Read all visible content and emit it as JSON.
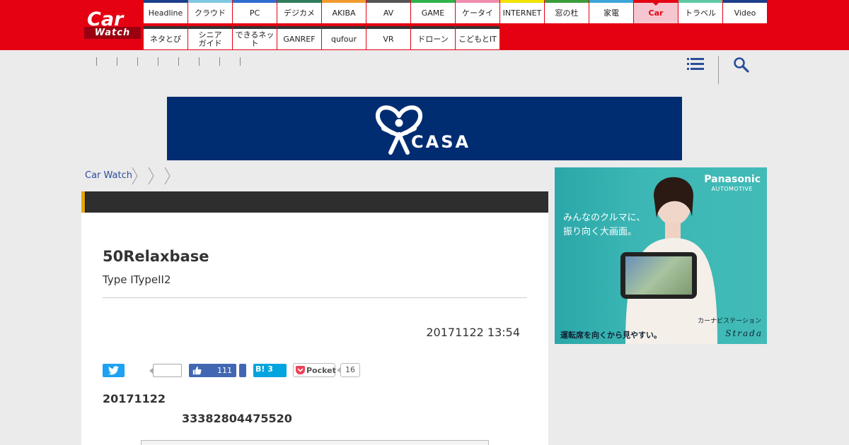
{
  "logo": {
    "line1": "Car",
    "line2": "Watch"
  },
  "nav": {
    "row1": [
      {
        "label": "Headline",
        "color": "#1d3f8b"
      },
      {
        "label": "クラウド",
        "color": "#7ec8e3"
      },
      {
        "label": "PC",
        "color": "#2f6ccf"
      },
      {
        "label": "デジカメ",
        "color": "#2e7d5b"
      },
      {
        "label": "AKIBA",
        "color": "#f29a2e"
      },
      {
        "label": "AV",
        "color": "#555555"
      },
      {
        "label": "GAME",
        "color": "#2db34a"
      },
      {
        "label": "ケータイ",
        "color": "#f08cb0"
      },
      {
        "label": "INTERNET",
        "color": "#f3e300"
      },
      {
        "label": "窓の杜",
        "color": "#3a9c3a"
      },
      {
        "label": "家電",
        "color": "#3da5d9"
      },
      {
        "label": "Car",
        "color": "#e50012",
        "active": true
      },
      {
        "label": "トラベル",
        "color": "#5fc9a5"
      },
      {
        "label": "Video",
        "color": "#1d3f8b"
      }
    ],
    "row2": [
      {
        "label": "ネタとぴ",
        "color": "#333333"
      },
      {
        "label": "シニア\nガイド",
        "color": "#333333"
      },
      {
        "label": "できるネット",
        "color": "#333333"
      },
      {
        "label": "GANREF",
        "color": "#333333"
      },
      {
        "label": "qufour",
        "color": "#333333"
      },
      {
        "label": "VR",
        "color": "#333333"
      },
      {
        "label": "ドローン",
        "color": "#333333"
      },
      {
        "label": "こどもとIT",
        "color": "#333333"
      }
    ]
  },
  "banner": {
    "text": "CASA"
  },
  "breadcrumb": {
    "home": "Car Watch"
  },
  "article": {
    "title": "50Relaxbase",
    "subtitle": "Type ITypeII2",
    "date": "20171122 13:54",
    "text1": "20171122",
    "text2": "33382804475520"
  },
  "share": {
    "facebook_count": "111",
    "hatena_label": "B! 3",
    "pocket_label": "Pocket",
    "pocket_count": "16"
  },
  "sidead": {
    "brand": "Panasonic",
    "brand_sub": "AUTOMOTIVE",
    "copy1": "みんなのクルマに、",
    "copy2": "振り向く大画面。",
    "product_type": "カーナビステーション",
    "tagline": "運転席を向くから見やすい。",
    "product": "Strada"
  }
}
